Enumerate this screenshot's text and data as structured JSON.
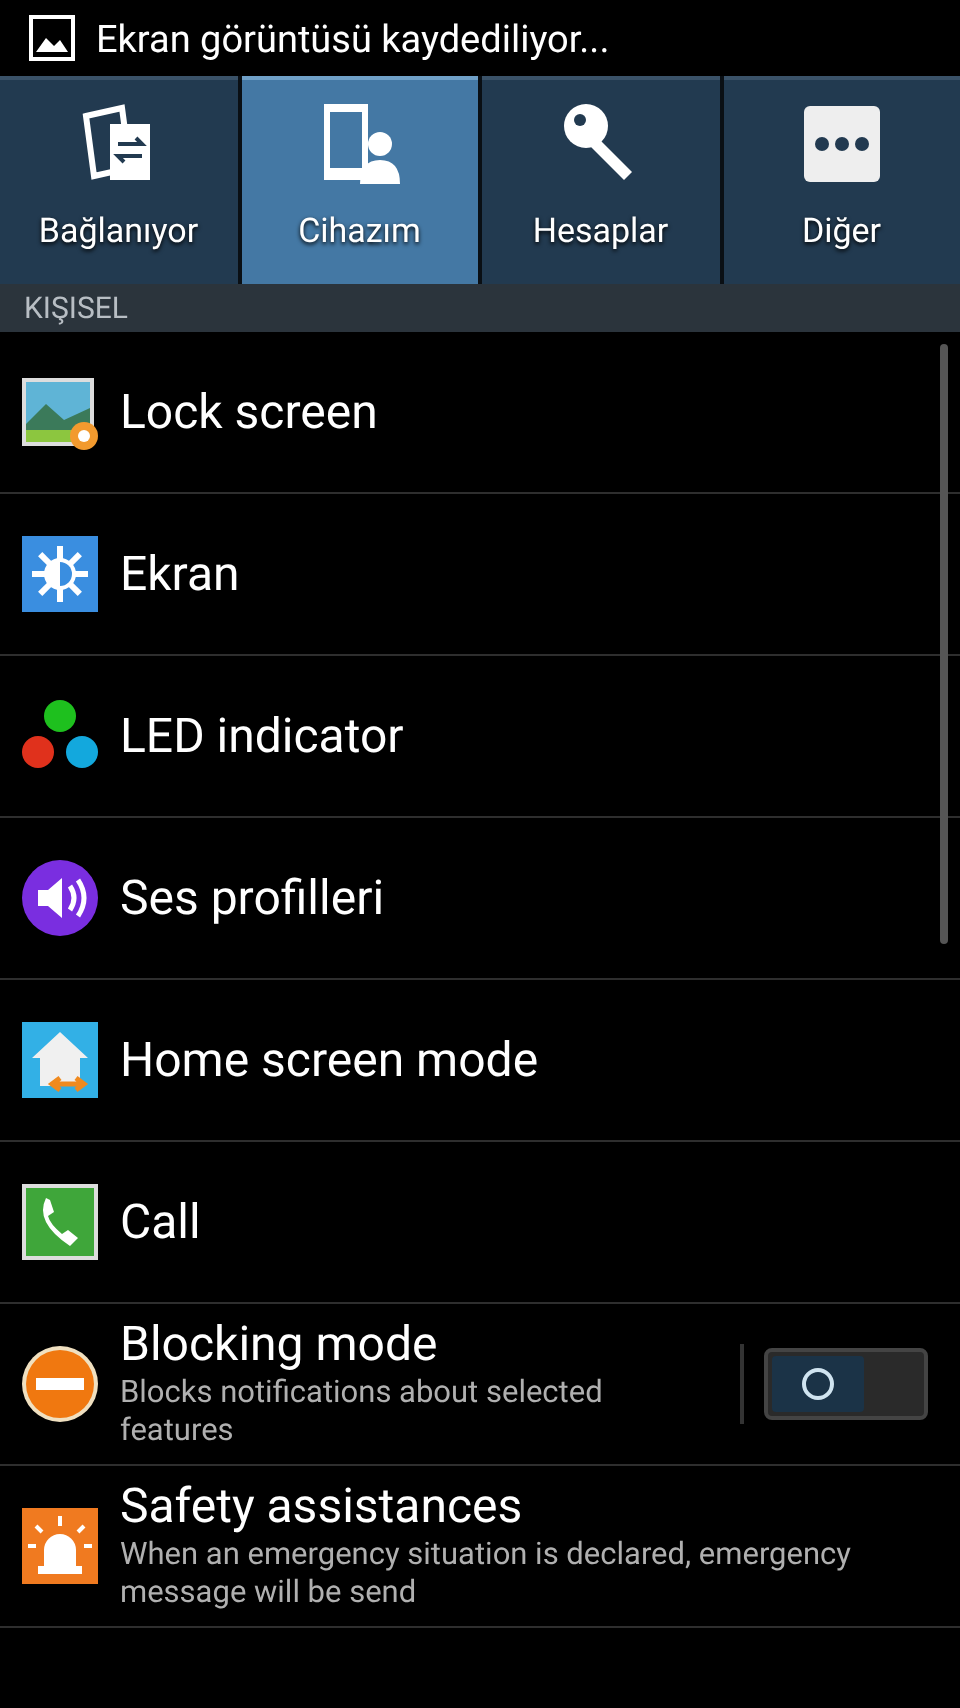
{
  "status_bar": {
    "notification": "Ekran görüntüsü kaydediliyor..."
  },
  "tabs": [
    {
      "label": "Bağlanıyor",
      "selected": false
    },
    {
      "label": "Cihazım",
      "selected": true
    },
    {
      "label": "Hesaplar",
      "selected": false
    },
    {
      "label": "Diğer",
      "selected": false
    }
  ],
  "section": {
    "title": "KIŞISEL"
  },
  "items": [
    {
      "kind": "plain",
      "title": "Lock screen"
    },
    {
      "kind": "plain",
      "title": "Ekran"
    },
    {
      "kind": "plain",
      "title": "LED indicator"
    },
    {
      "kind": "plain",
      "title": "Ses profilleri"
    },
    {
      "kind": "plain",
      "title": "Home screen mode"
    },
    {
      "kind": "plain",
      "title": "Call"
    },
    {
      "kind": "toggle",
      "title": "Blocking mode",
      "summary": "Blocks notifications about selected features",
      "on": false
    },
    {
      "kind": "summary",
      "title": "Safety assistances",
      "summary": "When an emergency situation is declared, emergency message will be send"
    }
  ]
}
